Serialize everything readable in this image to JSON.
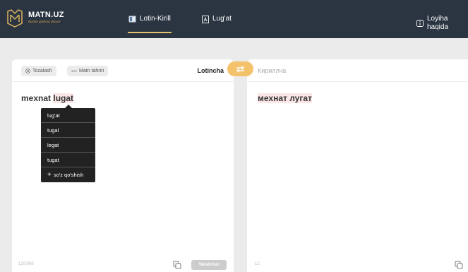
{
  "header": {
    "brand_name": "MATN.UZ",
    "brand_tagline": "Bizdan qiyinroq dunyo!",
    "nav": {
      "translit_label": "Lotin-Kirill",
      "dictionary_label": "Lug'at",
      "about_label": "Loyiha haqida"
    }
  },
  "source_panel": {
    "clear_label": "Tozalash",
    "edit_label": "Matn tahriri",
    "language": "Lotincha",
    "text_plain": "mexnat ",
    "text_flagged": "lugat",
    "char_count": "12/5000",
    "check_label": "Tekshirish"
  },
  "target_panel": {
    "language": "Кириллча",
    "text": "мехнат лугат",
    "char_count": "12"
  },
  "suggestions": {
    "items": [
      "lug'at",
      "tugal",
      "legat",
      "tugat"
    ],
    "add_label": "so'z qo'shish"
  },
  "icons": {
    "logo": "logo-icon",
    "translit": "book-icon",
    "dictionary": "dictionary-icon",
    "info": "info-icon",
    "clear": "x-circle-icon",
    "edit": "dots-icon",
    "swap": "swap-arrows-icon",
    "copy": "copy-icon",
    "add": "plus-icon"
  },
  "colors": {
    "topbar": "#2b3542",
    "accent": "#f4c26b",
    "underline": "#e4c16c",
    "flag_highlight": "#fbe6e6",
    "menu_bg": "#222222"
  }
}
